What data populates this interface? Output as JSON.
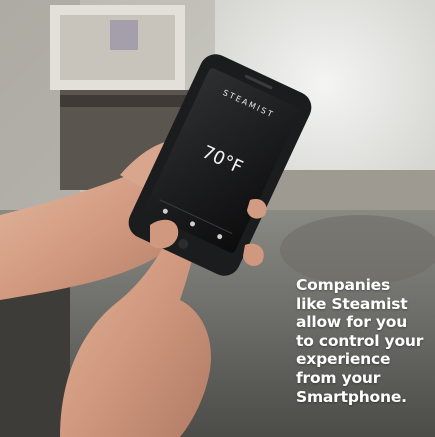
{
  "phone": {
    "brand": "STEAMIST",
    "temperature": "70°F"
  },
  "caption": {
    "lines": [
      "Companies",
      "like Steamist",
      "allow for you",
      "to control your",
      "experience",
      "from your",
      "Smartphone."
    ]
  }
}
